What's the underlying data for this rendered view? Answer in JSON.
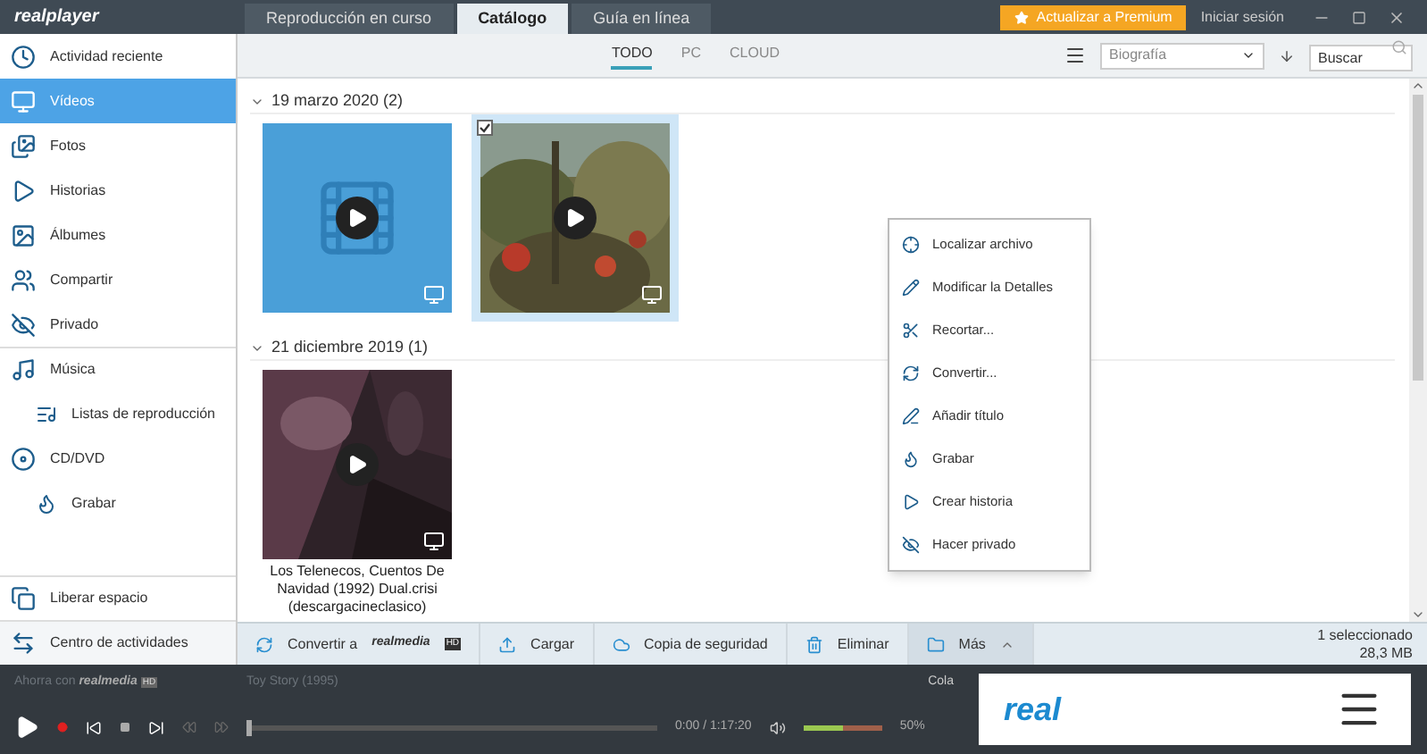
{
  "app": {
    "logo": "realplayer",
    "premium": "Actualizar a Premium",
    "signin": "Iniciar sesión"
  },
  "tabs": [
    {
      "label": "Reproducción en curso",
      "selected": false
    },
    {
      "label": "Catálogo",
      "selected": true
    },
    {
      "label": "Guía en línea",
      "selected": false
    }
  ],
  "sidebar": {
    "items": [
      {
        "label": "Actividad reciente",
        "selected": false
      },
      {
        "label": "Vídeos",
        "selected": true
      },
      {
        "label": "Fotos",
        "selected": false
      },
      {
        "label": "Historias",
        "selected": false
      },
      {
        "label": "Álbumes",
        "selected": false
      },
      {
        "label": "Compartir",
        "selected": false
      },
      {
        "label": "Privado",
        "selected": false
      },
      {
        "label": "Música",
        "selected": false,
        "children": [
          {
            "label": "Listas de reproducción",
            "selected": false
          }
        ]
      },
      {
        "label": "CD/DVD",
        "selected": false,
        "children": [
          {
            "label": "Grabar",
            "selected": false
          }
        ]
      }
    ],
    "footer": [
      "Liberar espacio",
      "Centro de actividades"
    ]
  },
  "filters": [
    {
      "label": "TODO",
      "selected": true
    },
    {
      "label": "PC",
      "selected": false
    },
    {
      "label": "CLOUD",
      "selected": false
    }
  ],
  "sort": {
    "value": "Biografía"
  },
  "search": {
    "placeholder": "Buscar"
  },
  "groups": [
    {
      "title": "19 marzo 2020 (2)",
      "items": [
        {
          "kind": "placeholder",
          "selected": false
        },
        {
          "kind": "picture",
          "selected": true
        }
      ]
    },
    {
      "title": "21 diciembre 2019 (1)",
      "items": [
        {
          "kind": "picture",
          "selected": false,
          "caption": "Los Telenecos, Cuentos De Navidad (1992) Dual.crisi (descargacineclasico)"
        }
      ]
    }
  ],
  "context_menu": [
    "Localizar archivo",
    "Modificar la Detalles",
    "Recortar...",
    "Convertir...",
    "Añadir título",
    "Grabar",
    "Crear historia",
    "Hacer privado"
  ],
  "actions": [
    {
      "label": "Convertir a",
      "brand": "realmedia",
      "badge": "HD"
    },
    {
      "label": "Cargar"
    },
    {
      "label": "Copia de seguridad"
    },
    {
      "label": "Eliminar"
    },
    {
      "label": "Más"
    }
  ],
  "selection": {
    "count": "1 seleccionado",
    "size": "28,3 MB"
  },
  "player": {
    "promo": "Ahorra con",
    "promo_brand": "realmedia",
    "promo_badge": "HD",
    "title": "Toy Story (1995)",
    "queue": "Cola",
    "time": "0:00 / 1:17:20",
    "volume": {
      "level": 0.5,
      "reading": "50%"
    },
    "progress": {
      "level": 0
    },
    "logo": "real"
  }
}
